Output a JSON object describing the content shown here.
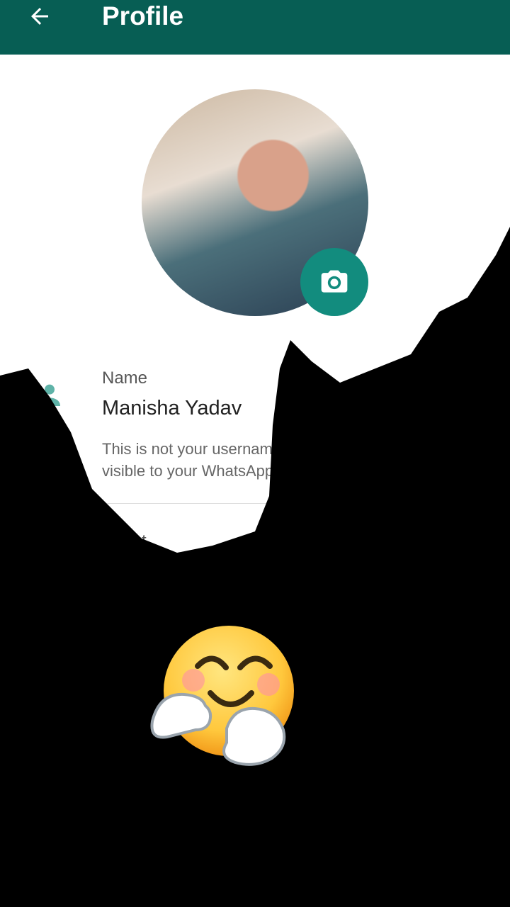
{
  "appbar": {
    "title": "Profile",
    "back_icon": "arrow-left-icon"
  },
  "profile": {
    "photo_alt": "Profile photo",
    "camera_icon": "camera-icon",
    "name_label": "Name",
    "name_value": "Manisha Yadav",
    "name_hint": "This is not your username or pin. This name will be visible to your WhatsApp contacts.",
    "about_label": "About"
  },
  "overlay": {
    "sticker_icon": "hugging-face-emoji"
  },
  "colors": {
    "appbar": "#075e54",
    "accent": "#128c7e",
    "icon": "#5fb3a8"
  }
}
